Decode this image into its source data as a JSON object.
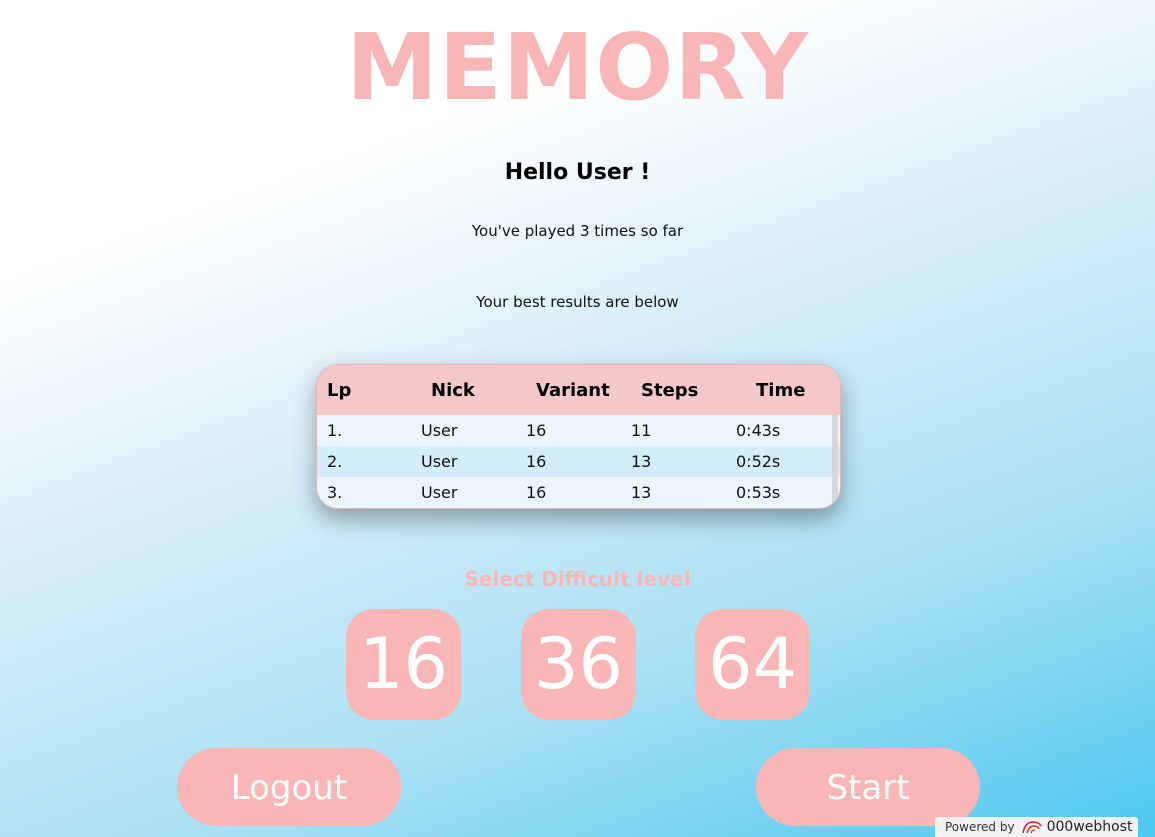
{
  "app": {
    "title": "MEMORY"
  },
  "greeting": "Hello User !",
  "played_text": "You've played 3 times so far",
  "best_text": "Your best results are below",
  "results_table": {
    "headers": [
      "Lp",
      "Nick",
      "Variant",
      "Steps",
      "Time"
    ],
    "rows": [
      [
        "1.",
        "User",
        "16",
        "11",
        "0:43s"
      ],
      [
        "2.",
        "User",
        "16",
        "13",
        "0:52s"
      ],
      [
        "3.",
        "User",
        "16",
        "13",
        "0:53s"
      ]
    ]
  },
  "difficulty": {
    "label": "Select Difficult level",
    "levels": [
      "16",
      "36",
      "64"
    ]
  },
  "buttons": {
    "logout": "Logout",
    "start": "Start"
  },
  "footer": {
    "powered_by": "Powered by",
    "brand": "000webhost"
  },
  "colors": {
    "accent": "#f8b7b6",
    "table_header": "#f4c8c9",
    "bg_bottom": "#4cc8ef"
  }
}
